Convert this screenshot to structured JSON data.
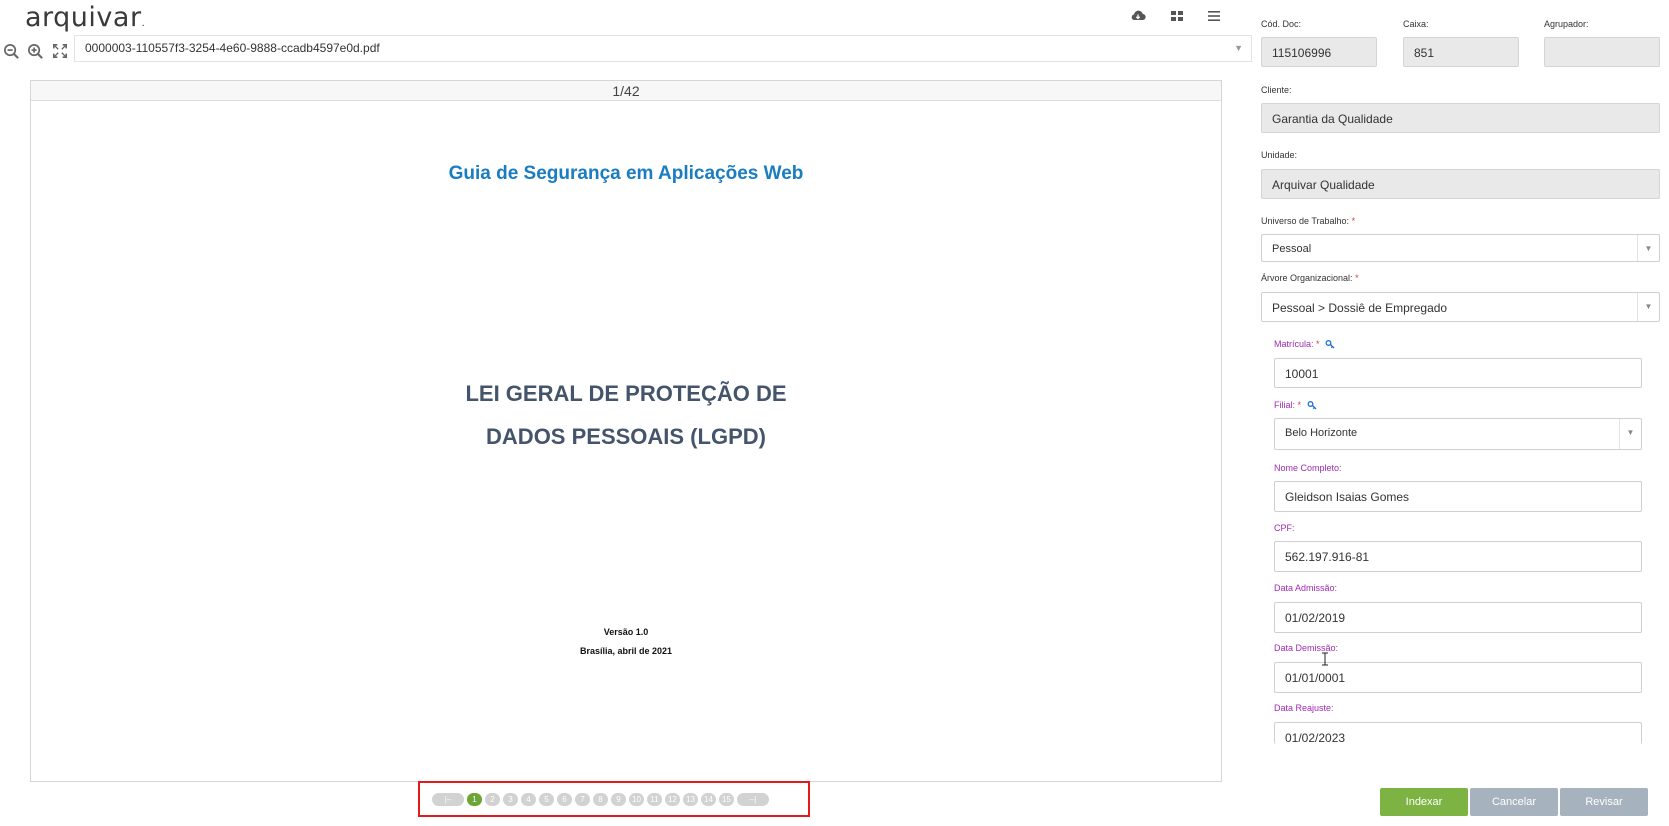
{
  "app": {
    "logo": "arquivar"
  },
  "toolbar": {
    "icons": [
      "cloud-download-icon",
      "grid-icon",
      "menu-icon"
    ]
  },
  "viewer": {
    "file_name": "0000003-110557f3-3254-4e60-9888-ccadb4597e0d.pdf",
    "page_indicator": "1/42",
    "document": {
      "subtitle": "Guia de Segurança em Aplicações Web",
      "title_line1": "LEI GERAL DE PROTEÇÃO DE",
      "title_line2": "DADOS PESSOAIS (LGPD)",
      "version": "Versão 1.0",
      "place_date": "Brasília, abril de 2021"
    },
    "pager": {
      "first": "|–",
      "last": "–|",
      "pages": [
        "1",
        "2",
        "3",
        "4",
        "5",
        "6",
        "7",
        "8",
        "9",
        "10",
        "11",
        "12",
        "13",
        "14",
        "15"
      ],
      "active": "1"
    }
  },
  "form": {
    "cod_doc": {
      "label": "Cód. Doc:",
      "value": "115106996"
    },
    "caixa": {
      "label": "Caixa:",
      "value": "851"
    },
    "agrupador": {
      "label": "Agrupador:",
      "value": ""
    },
    "cliente": {
      "label": "Cliente:",
      "value": "Garantia da Qualidade"
    },
    "unidade": {
      "label": "Unidade:",
      "value": "Arquivar Qualidade"
    },
    "universo": {
      "label": "Universo de Trabalho:",
      "required": "*",
      "value": "Pessoal"
    },
    "arvore": {
      "label": "Árvore Organizacional:",
      "required": "*",
      "value": "Pessoal > Dossiê de Empregado"
    },
    "matricula": {
      "label": "Matrícula:",
      "required": "*",
      "value": "10001"
    },
    "filial": {
      "label": "Filial:",
      "required": "*",
      "value": "Belo Horizonte"
    },
    "nome": {
      "label": "Nome Completo:",
      "value": "Gleidson Isaias Gomes"
    },
    "cpf": {
      "label": "CPF:",
      "value": "562.197.916-81"
    },
    "data_admissao": {
      "label": "Data Admissão:",
      "value": "01/02/2019"
    },
    "data_demissao": {
      "label": "Data Demissão:",
      "value": "01/01/0001"
    },
    "data_reajuste": {
      "label": "Data Reajuste:",
      "value": "01/02/2023"
    }
  },
  "actions": {
    "indexar": "Indexar",
    "cancelar": "Cancelar",
    "revisar": "Revisar"
  },
  "colors": {
    "accent_green": "#7cb342",
    "pager_active": "#6aa535",
    "label_purple": "#a02bb4",
    "highlight_red": "#e41b1b",
    "doc_blue": "#1a7cc1"
  }
}
